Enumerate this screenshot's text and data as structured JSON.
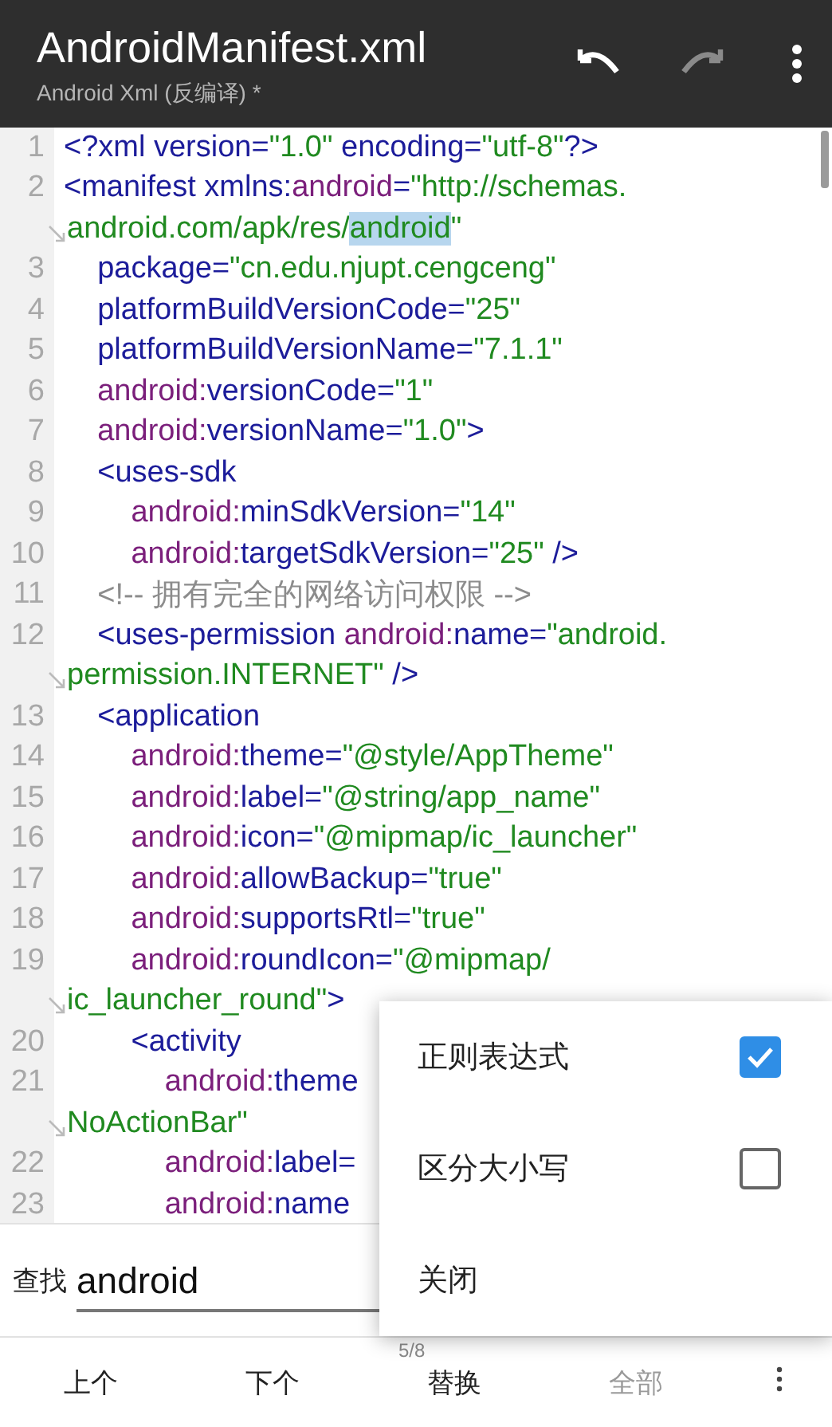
{
  "header": {
    "title": "AndroidManifest.xml",
    "subtitle": "Android Xml (反编译) *"
  },
  "toolbar": [
    {
      "kind": "undo",
      "disabled": false
    },
    {
      "kind": "redo",
      "disabled": true
    },
    {
      "kind": "more"
    }
  ],
  "code": {
    "rows": [
      {
        "kind": "line",
        "num": "1",
        "segments": [
          {
            "kind": "t",
            "text": "<?xml version="
          },
          {
            "kind": "v",
            "text": "\"1.0\""
          },
          {
            "kind": "t",
            "text": " encoding="
          },
          {
            "kind": "v",
            "text": "\"utf-8\""
          },
          {
            "kind": "t",
            "text": "?>"
          }
        ]
      },
      {
        "kind": "line",
        "num": "2",
        "segments": [
          {
            "kind": "t",
            "text": "<manifest xmlns:"
          },
          {
            "kind": "n",
            "text": "android"
          },
          {
            "kind": "t",
            "text": "="
          },
          {
            "kind": "v",
            "text": "\"http://schemas."
          }
        ]
      },
      {
        "kind": "wrap",
        "segments": [
          {
            "kind": "v",
            "text": "android.com/apk/res/"
          },
          {
            "kind": "m",
            "text": "android"
          },
          {
            "kind": "v",
            "text": "\""
          }
        ]
      },
      {
        "kind": "line",
        "num": "3",
        "segments": [
          {
            "kind": "t",
            "text": "    package="
          },
          {
            "kind": "v",
            "text": "\"cn.edu.njupt.cengceng\""
          }
        ]
      },
      {
        "kind": "line",
        "num": "4",
        "segments": [
          {
            "kind": "t",
            "text": "    platformBuildVersionCode="
          },
          {
            "kind": "v",
            "text": "\"25\""
          }
        ]
      },
      {
        "kind": "line",
        "num": "5",
        "segments": [
          {
            "kind": "t",
            "text": "    platformBuildVersionName="
          },
          {
            "kind": "v",
            "text": "\"7.1.1\""
          }
        ]
      },
      {
        "kind": "line",
        "num": "6",
        "segments": [
          {
            "kind": "n",
            "text": "    android:"
          },
          {
            "kind": "t",
            "text": "versionCode="
          },
          {
            "kind": "v",
            "text": "\"1\""
          }
        ]
      },
      {
        "kind": "line",
        "num": "7",
        "segments": [
          {
            "kind": "n",
            "text": "    android:"
          },
          {
            "kind": "t",
            "text": "versionName="
          },
          {
            "kind": "v",
            "text": "\"1.0\""
          },
          {
            "kind": "t",
            "text": ">"
          }
        ]
      },
      {
        "kind": "line",
        "num": "8",
        "segments": [
          {
            "kind": "t",
            "text": "    <uses-sdk"
          }
        ]
      },
      {
        "kind": "line",
        "num": "9",
        "segments": [
          {
            "kind": "n",
            "text": "        android:"
          },
          {
            "kind": "t",
            "text": "minSdkVersion="
          },
          {
            "kind": "v",
            "text": "\"14\""
          }
        ]
      },
      {
        "kind": "line",
        "num": "10",
        "segments": [
          {
            "kind": "n",
            "text": "        android:"
          },
          {
            "kind": "t",
            "text": "targetSdkVersion="
          },
          {
            "kind": "v",
            "text": "\"25\""
          },
          {
            "kind": "t",
            "text": " />"
          }
        ]
      },
      {
        "kind": "line",
        "num": "11",
        "segments": [
          {
            "kind": "c",
            "text": "    <!-- 拥有完全的网络访问权限 -->"
          }
        ]
      },
      {
        "kind": "line",
        "num": "12",
        "segments": [
          {
            "kind": "t",
            "text": "    <uses-permission "
          },
          {
            "kind": "n",
            "text": "android:"
          },
          {
            "kind": "t",
            "text": "name="
          },
          {
            "kind": "v",
            "text": "\"android."
          }
        ]
      },
      {
        "kind": "wrap",
        "segments": [
          {
            "kind": "v",
            "text": "permission.INTERNET\""
          },
          {
            "kind": "t",
            "text": " />"
          }
        ]
      },
      {
        "kind": "line",
        "num": "13",
        "segments": [
          {
            "kind": "t",
            "text": "    <application"
          }
        ]
      },
      {
        "kind": "line",
        "num": "14",
        "segments": [
          {
            "kind": "n",
            "text": "        android:"
          },
          {
            "kind": "t",
            "text": "theme="
          },
          {
            "kind": "v",
            "text": "\"@style/AppTheme\""
          }
        ]
      },
      {
        "kind": "line",
        "num": "15",
        "segments": [
          {
            "kind": "n",
            "text": "        android:"
          },
          {
            "kind": "t",
            "text": "label="
          },
          {
            "kind": "v",
            "text": "\"@string/app_name\""
          }
        ]
      },
      {
        "kind": "line",
        "num": "16",
        "segments": [
          {
            "kind": "n",
            "text": "        android:"
          },
          {
            "kind": "t",
            "text": "icon="
          },
          {
            "kind": "v",
            "text": "\"@mipmap/ic_launcher\""
          }
        ]
      },
      {
        "kind": "line",
        "num": "17",
        "segments": [
          {
            "kind": "n",
            "text": "        android:"
          },
          {
            "kind": "t",
            "text": "allowBackup="
          },
          {
            "kind": "v",
            "text": "\"true\""
          }
        ]
      },
      {
        "kind": "line",
        "num": "18",
        "segments": [
          {
            "kind": "n",
            "text": "        android:"
          },
          {
            "kind": "t",
            "text": "supportsRtl="
          },
          {
            "kind": "v",
            "text": "\"true\""
          }
        ]
      },
      {
        "kind": "line",
        "num": "19",
        "segments": [
          {
            "kind": "n",
            "text": "        android:"
          },
          {
            "kind": "t",
            "text": "roundIcon="
          },
          {
            "kind": "v",
            "text": "\"@mipmap/"
          }
        ]
      },
      {
        "kind": "wrap",
        "segments": [
          {
            "kind": "v",
            "text": "ic_launcher_round\""
          },
          {
            "kind": "t",
            "text": ">"
          }
        ]
      },
      {
        "kind": "line",
        "num": "20",
        "segments": [
          {
            "kind": "t",
            "text": "        <activity"
          }
        ]
      },
      {
        "kind": "line",
        "num": "21",
        "segments": [
          {
            "kind": "n",
            "text": "            android:"
          },
          {
            "kind": "t",
            "text": "theme"
          }
        ]
      },
      {
        "kind": "wrap",
        "segments": [
          {
            "kind": "v",
            "text": "NoActionBar\""
          }
        ]
      },
      {
        "kind": "line",
        "num": "22",
        "segments": [
          {
            "kind": "n",
            "text": "            android:"
          },
          {
            "kind": "t",
            "text": "label="
          }
        ]
      },
      {
        "kind": "line",
        "num": "23",
        "segments": [
          {
            "kind": "n",
            "text": "            android:"
          },
          {
            "kind": "t",
            "text": "name"
          }
        ]
      }
    ]
  },
  "find": {
    "label": "查找",
    "value": "android"
  },
  "match_count": "5/8",
  "actions": [
    {
      "kind": "text",
      "label": "上个",
      "disabled": false
    },
    {
      "kind": "text",
      "label": "下个",
      "disabled": false
    },
    {
      "kind": "text",
      "label": "替换",
      "disabled": false
    },
    {
      "kind": "text",
      "label": "全部",
      "disabled": true
    },
    {
      "kind": "more"
    }
  ],
  "menu": {
    "items": [
      {
        "kind": "check",
        "label": "正则表达式",
        "checked": true
      },
      {
        "kind": "check",
        "label": "区分大小写",
        "checked": false
      },
      {
        "kind": "action",
        "label": "关闭"
      }
    ]
  }
}
